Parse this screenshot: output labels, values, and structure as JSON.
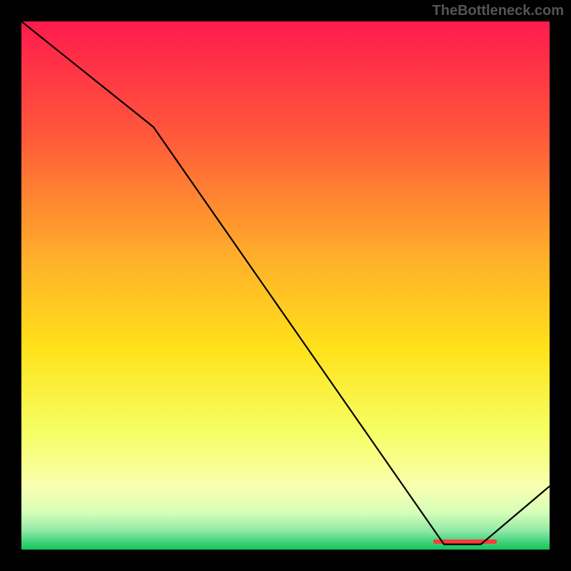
{
  "watermark": "TheBottleneck.com",
  "chart_data": {
    "type": "line",
    "title": "",
    "xlabel": "",
    "ylabel": "",
    "xlim": [
      0,
      100
    ],
    "ylim": [
      0,
      100
    ],
    "series": [
      {
        "name": "curve",
        "x": [
          0,
          25,
          80,
          87,
          100
        ],
        "y": [
          100,
          80,
          1,
          1,
          12
        ]
      }
    ],
    "gradient_stops": [
      {
        "offset": 0.0,
        "color": "#ff1a4d"
      },
      {
        "offset": 0.22,
        "color": "#ff5a3a"
      },
      {
        "offset": 0.45,
        "color": "#ffb02a"
      },
      {
        "offset": 0.62,
        "color": "#ffe21a"
      },
      {
        "offset": 0.78,
        "color": "#f6ff66"
      },
      {
        "offset": 0.88,
        "color": "#f9ffb0"
      },
      {
        "offset": 0.93,
        "color": "#d6ffb8"
      },
      {
        "offset": 0.965,
        "color": "#8fe8a6"
      },
      {
        "offset": 0.985,
        "color": "#3fd47a"
      },
      {
        "offset": 1.0,
        "color": "#14c45e"
      }
    ],
    "bottom_marker": {
      "x_start": 78,
      "x_end": 90,
      "y": 1.5,
      "color": "#ff3a3a",
      "label": ""
    }
  }
}
